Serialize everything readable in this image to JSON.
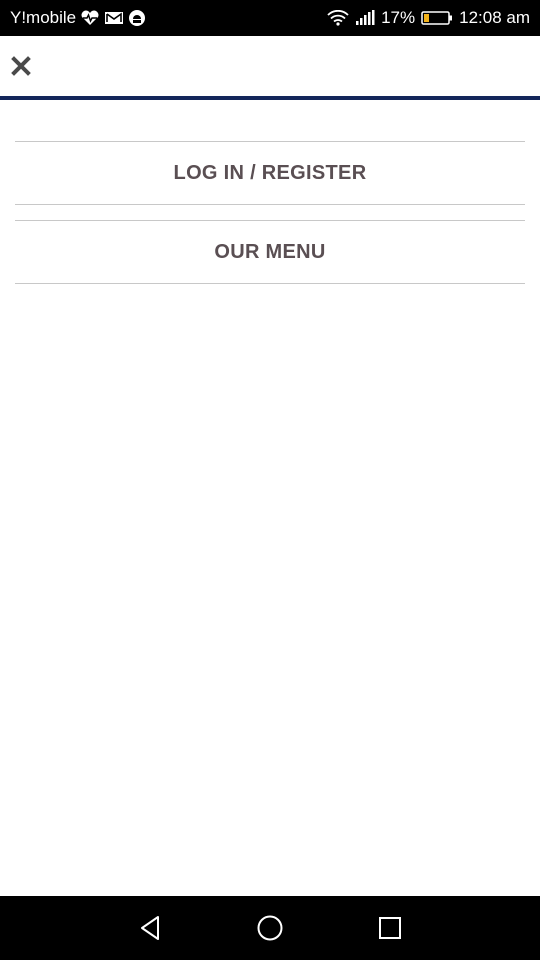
{
  "status_bar": {
    "carrier": "Y!mobile",
    "battery_percent": "17%",
    "time": "12:08 am",
    "left_icons": [
      "heart-rate-icon",
      "mail-icon",
      "android-icon"
    ],
    "right_icons": [
      "wifi-icon",
      "signal-icon",
      "battery-icon"
    ]
  },
  "header": {
    "close_icon": "close-icon",
    "accent_color": "#13265a"
  },
  "menu": {
    "items": [
      {
        "label": "LOG IN / REGISTER"
      },
      {
        "label": "OUR MENU"
      }
    ],
    "text_color": "#5a4f53"
  },
  "nav_bar": {
    "buttons": [
      "back-icon",
      "home-icon",
      "recents-icon"
    ]
  }
}
